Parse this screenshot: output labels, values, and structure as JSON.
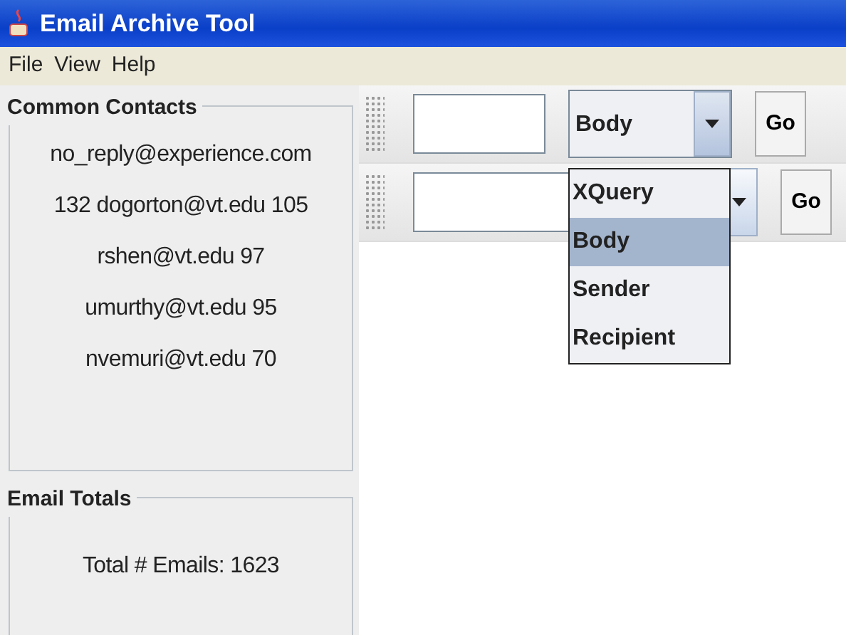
{
  "window": {
    "title": "Email Archive Tool"
  },
  "menu": [
    "File",
    "View",
    "Help"
  ],
  "contacts": {
    "title": "Common Contacts",
    "items": [
      "no_reply@experience.com",
      "132 dogorton@vt.edu 105",
      "rshen@vt.edu 97",
      "umurthy@vt.edu 95",
      "nvemuri@vt.edu 70"
    ]
  },
  "totals": {
    "title": "Email Totals",
    "text": "Total # Emails: 1623"
  },
  "search_rows": [
    {
      "combo": "Body",
      "expanded": true,
      "options": [
        {
          "label": "XQuery",
          "selected": false
        },
        {
          "label": "Body",
          "selected": true
        },
        {
          "label": "Sender",
          "selected": false
        },
        {
          "label": "Recipient",
          "selected": false
        }
      ],
      "button": "Go"
    },
    {
      "expanded": false,
      "button": "Go"
    }
  ]
}
